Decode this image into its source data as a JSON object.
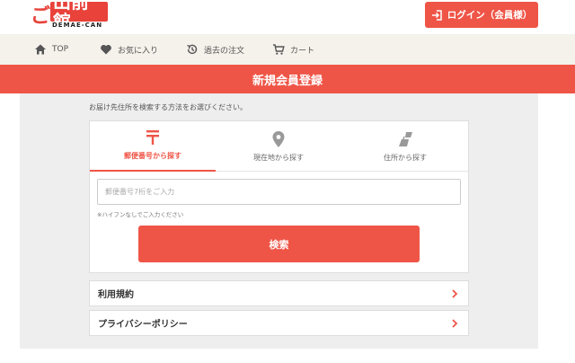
{
  "logo": {
    "ko": "ご",
    "main": "出前館",
    "sub": "DEMAE-CAN"
  },
  "header": {
    "login_label": "ログイン（会員様）"
  },
  "nav": {
    "items": [
      {
        "label": "TOP",
        "icon": "home-icon"
      },
      {
        "label": "お気に入り",
        "icon": "heart-icon"
      },
      {
        "label": "過去の注文",
        "icon": "history-icon"
      },
      {
        "label": "カート",
        "icon": "cart-icon"
      }
    ]
  },
  "page": {
    "title": "新規会員登録",
    "intro": "お届け先住所を検索する方法をお選びください。"
  },
  "tabs": [
    {
      "label": "郵便番号から探す",
      "icon": "postal-mark-icon",
      "active": true
    },
    {
      "label": "現在地から探す",
      "icon": "location-pin-icon",
      "active": false
    },
    {
      "label": "住所から探す",
      "icon": "map-icon",
      "active": false
    }
  ],
  "search": {
    "placeholder": "郵便番号7桁をご入力",
    "value": "",
    "note": "※ハイフンなしでご入力ください",
    "button_label": "検索"
  },
  "links": [
    {
      "label": "利用規約"
    },
    {
      "label": "プライバシーポリシー"
    }
  ],
  "colors": {
    "accent": "#ef5547",
    "nav_bg": "#f5f1eb",
    "content_bg": "#eeeeee"
  }
}
